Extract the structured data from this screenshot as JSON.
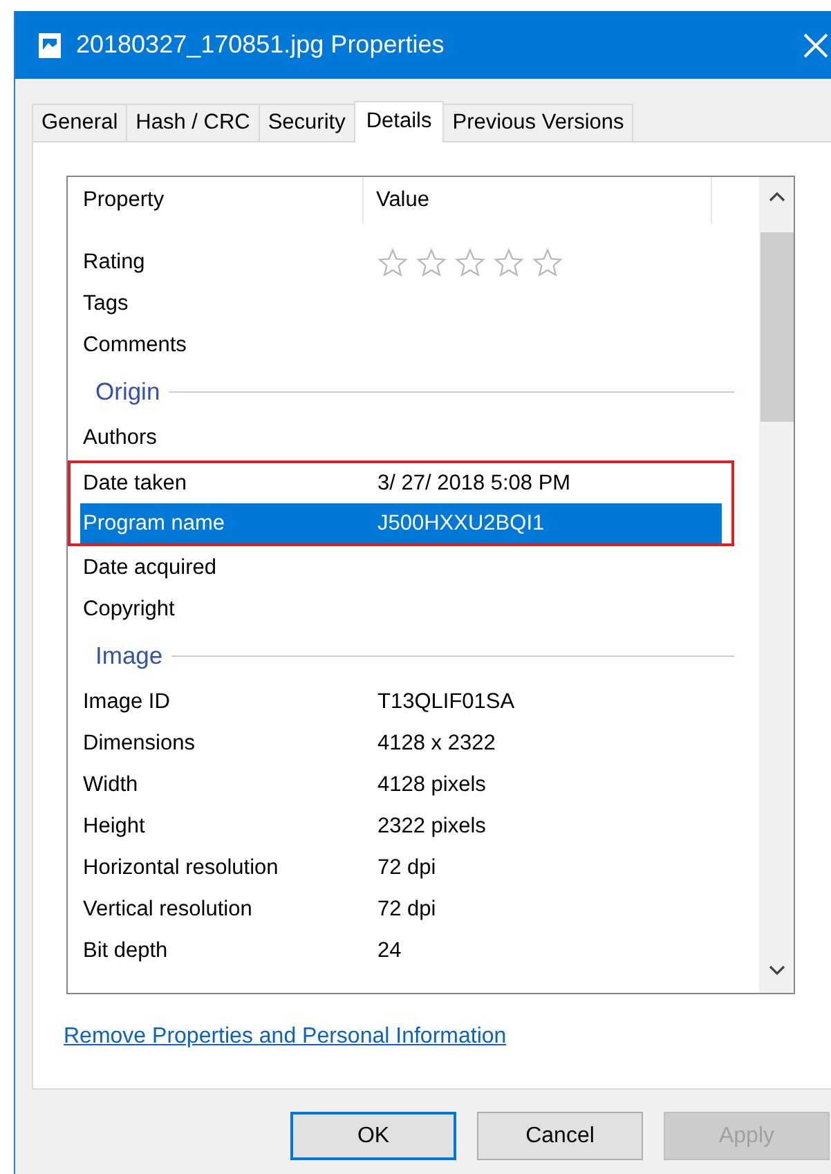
{
  "window": {
    "title": "20180327_170851.jpg Properties"
  },
  "tabs": [
    {
      "label": "General",
      "selected": false
    },
    {
      "label": "Hash / CRC",
      "selected": false
    },
    {
      "label": "Security",
      "selected": false
    },
    {
      "label": "Details",
      "selected": true
    },
    {
      "label": "Previous Versions",
      "selected": false
    }
  ],
  "table": {
    "columns": [
      "Property",
      "Value"
    ],
    "rows": [
      {
        "kind": "rating",
        "property": "Rating",
        "stars": 0,
        "selected": false,
        "outlined": false
      },
      {
        "kind": "row",
        "property": "Tags",
        "value": "",
        "selected": false,
        "outlined": false
      },
      {
        "kind": "row",
        "property": "Comments",
        "value": "",
        "selected": false,
        "outlined": false
      },
      {
        "kind": "section",
        "title": "Origin"
      },
      {
        "kind": "row",
        "property": "Authors",
        "value": "",
        "selected": false,
        "outlined": false
      },
      {
        "kind": "row",
        "property": "Date taken",
        "value": "3/ 27/ 2018 5:08 PM",
        "selected": false,
        "outlined": true
      },
      {
        "kind": "row",
        "property": "Program name",
        "value": "J500HXXU2BQI1",
        "selected": true,
        "outlined": true
      },
      {
        "kind": "row",
        "property": "Date acquired",
        "value": "",
        "selected": false,
        "outlined": false
      },
      {
        "kind": "row",
        "property": "Copyright",
        "value": "",
        "selected": false,
        "outlined": false
      },
      {
        "kind": "section",
        "title": "Image"
      },
      {
        "kind": "row",
        "property": "Image ID",
        "value": "T13QLIF01SA",
        "selected": false,
        "outlined": false
      },
      {
        "kind": "row",
        "property": "Dimensions",
        "value": "4128 x 2322",
        "selected": false,
        "outlined": false
      },
      {
        "kind": "row",
        "property": "Width",
        "value": "4128 pixels",
        "selected": false,
        "outlined": false
      },
      {
        "kind": "row",
        "property": "Height",
        "value": "2322 pixels",
        "selected": false,
        "outlined": false
      },
      {
        "kind": "row",
        "property": "Horizontal resolution",
        "value": "72 dpi",
        "selected": false,
        "outlined": false
      },
      {
        "kind": "row",
        "property": "Vertical resolution",
        "value": "72 dpi",
        "selected": false,
        "outlined": false
      },
      {
        "kind": "row",
        "property": "Bit depth",
        "value": "24",
        "selected": false,
        "outlined": false
      }
    ]
  },
  "link": "Remove Properties and Personal Information",
  "buttons": [
    {
      "label": "OK",
      "kind": "default",
      "disabled": false
    },
    {
      "label": "Cancel",
      "kind": "normal",
      "disabled": false
    },
    {
      "label": "Apply",
      "kind": "normal",
      "disabled": true
    }
  ]
}
